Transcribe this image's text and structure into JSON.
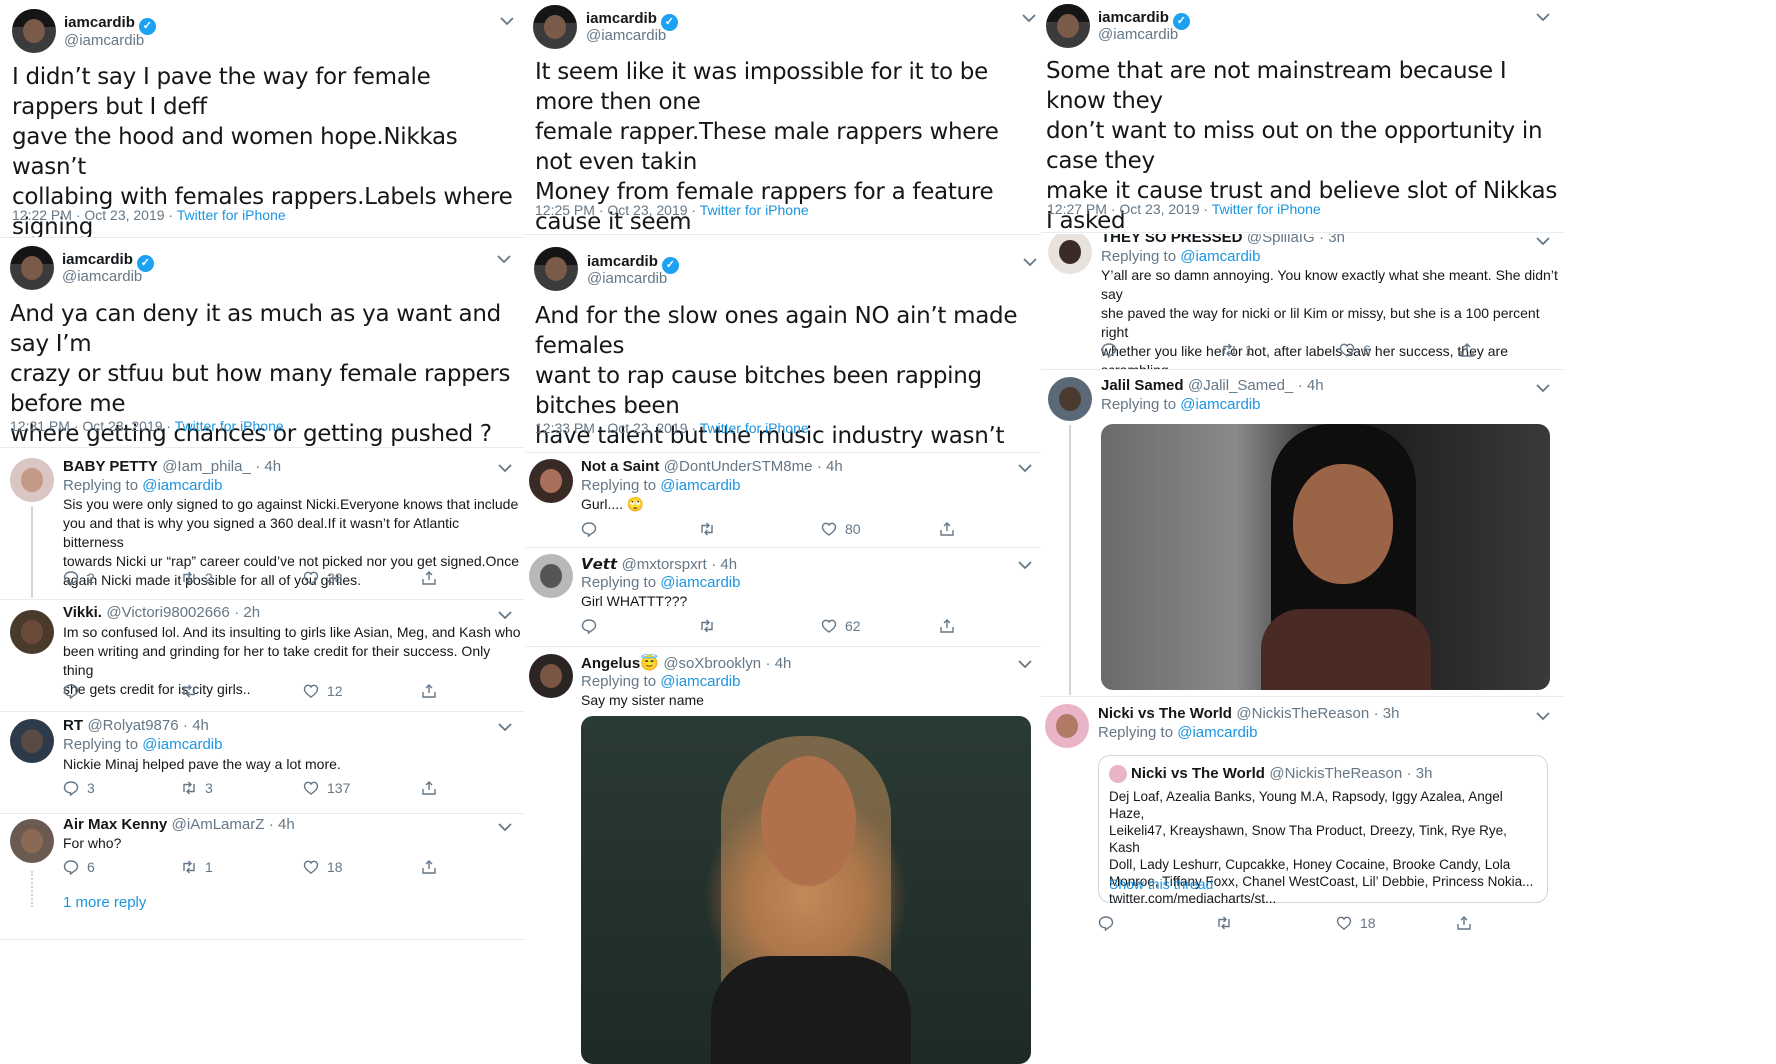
{
  "colors": {
    "link": "#1b95e0",
    "verified": "#1da1f2",
    "secondary": "#657786",
    "text": "#14171a"
  },
  "main_user": {
    "name": "iamcardib",
    "handle": "@iamcardib",
    "verified_mark": "✓"
  },
  "reply_prefix": "Replying to",
  "reply_at": "@iamcardib",
  "tweets": [
    {
      "text": "I didn’t say I pave the way for female rappers but I deff\ngave the hood and women hope.Nikkas wasn’t\ncollabing with females rappers.Labels where signing\nfemale rappers and putting them in a shelf and not\nfocusing on them.Not giving them proper attention .",
      "time": "12:22 PM · Oct 23, 2019 · ",
      "source": "Twitter for iPhone"
    },
    {
      "text": "It seem like it was impossible for it to be more then one\nfemale rapper.These male rappers where not even takin\nMoney from female rappers for a feature cause it seem\nfar fetch for another woman to make it.I see so many\nmale artists collabing wit females now even ..",
      "time": "12:25 PM · Oct 23, 2019 · ",
      "source": "Twitter for iPhone"
    },
    {
      "text": "Some that are not mainstream because I know they\ndon’t want to miss out on the opportunity in case they\nmake it cause trust and believe slot of Nikkas I asked\nfor features from when they see me they tell me “I\nshoulda believe”Deum I should have did the feature .",
      "time": "12:27 PM · Oct 23, 2019 · ",
      "source": "Twitter for iPhone"
    },
    {
      "text": "And ya can deny it as much as ya want and say I’m\ncrazy or stfuu but how many female rappers before me\nwhere getting chances or getting pushed ? They wasn’t\nbelieving and now they are !",
      "time": "12:31 PM · Oct 23, 2019 · ",
      "source": "Twitter for iPhone"
    },
    {
      "text": "And for the slow ones again NO ain’t made females\nwant to rap cause bitches been rapping bitches been\nhave talent but the music industry wasn’t believing and\nshitting on female rappers .and that’s Big Bentley.",
      "time": "12:33 PM · Oct 23, 2019 · ",
      "source": "Twitter for iPhone"
    }
  ],
  "replies_col1": [
    {
      "name": "BABY PETTY",
      "handle": "@Iam_phila_",
      "age": "· 4h",
      "text": "Sis you were only signed to go against Nicki.Everyone knows that include\nyou and that is why you signed a 360 deal.If it wasn’t for Atlantic bitterness\ntowards Nicki ur “rap” career could’ve not picked nor you get signed.Once\nagain Nicki made it possible for all of you girlies.",
      "replies": "2",
      "retweets": "2",
      "likes": "38"
    },
    {
      "name": "Vikki.",
      "handle": "@Victori98002666",
      "age": "· 2h",
      "text": "Im so confused lol. And its insulting to girls like Asian, Meg, and Kash who\nbeen writing and grinding for her to take credit for their success. Only thing\nshe gets credit for is city girls..",
      "replies": "",
      "retweets": "",
      "likes": "12"
    },
    {
      "name": "RT",
      "handle": "@Rolyat9876",
      "age": "· 4h",
      "text": "Nickie Minaj helped pave the way a lot more.",
      "replies": "3",
      "retweets": "3",
      "likes": "137"
    },
    {
      "name": "Air Max Kenny",
      "handle": "@iAmLamarZ",
      "age": "· 4h",
      "text": "For who?",
      "replies": "6",
      "retweets": "1",
      "likes": "18"
    }
  ],
  "more_replies": "1 more reply",
  "replies_col2": [
    {
      "name": "Not a Saint",
      "handle": "@DontUnderSTM8me",
      "age": "· 4h",
      "text": "Gurl.... 🙄",
      "replies": "",
      "retweets": "",
      "likes": "80"
    },
    {
      "name": "𝙑𝙚𝙩𝙩",
      "handle": "@mxtorspxrt",
      "age": "· 4h",
      "text": "Girl WHATTT???",
      "replies": "",
      "retweets": "",
      "likes": "62"
    },
    {
      "name": "Angelus😇",
      "handle": "@soXbrooklyn",
      "age": "· 4h",
      "text": "Say my sister name"
    }
  ],
  "replies_col3": [
    {
      "name": "THEY SO PRESSED",
      "handle": "@SpillaIG",
      "age": "· 3h",
      "text": "Y’all are so damn annoying. You know exactly what she meant. She didn’t say\nshe paved the way for nicki or lil Kim or missy, but she is a 100 percent right\nwhether you like her or not, after labels saw her success, they are scrambling\nto find the next successful female rapper 🤦🏽‍♀️",
      "replies": "",
      "retweets": "1",
      "likes": "6"
    },
    {
      "name": "Jalil Samed",
      "handle": "@Jalil_Samed_",
      "age": "· 4h"
    },
    {
      "name": "Nicki vs The World",
      "handle": "@NickisTheReason",
      "age": "· 3h",
      "replies": "",
      "retweets": "",
      "likes": "18"
    }
  ],
  "quote": {
    "name": "Nicki vs The World",
    "handle": "@NickisTheReason",
    "age": "· 3h",
    "text": "Dej Loaf, Azealia Banks, Young M.A, Rapsody, Iggy Azalea, Angel Haze,\nLeikeli47, Kreayshawn, Snow Tha Product, Dreezy, Tink, Rye Rye, Kash\nDoll, Lady Leshurr, Cupcakke, Honey Cocaine, Brooke Candy, Lola\nMonroe, Tiffany Foxx, Chanel WestCoast, Lil’ Debbie, Princess Nokia...\ntwitter.com/mediacharts/st...",
    "show_thread": "Show this thread"
  }
}
